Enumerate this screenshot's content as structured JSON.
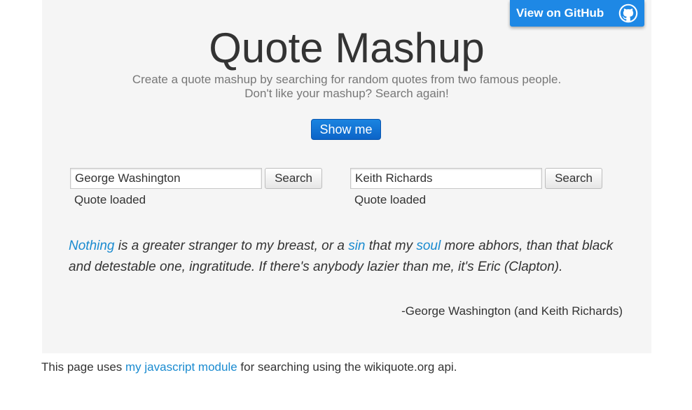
{
  "github": {
    "label": "View on GitHub",
    "icon": "github-octocat-icon"
  },
  "header": {
    "title": "Quote Mashup",
    "subtitle_line1": "Create a quote mashup by searching for random quotes from two famous people.",
    "subtitle_line2": "Don't like your mashup? Search again!"
  },
  "show_button": {
    "label": "Show me"
  },
  "search_left": {
    "value": "George Washington",
    "button": "Search",
    "status": "Quote loaded"
  },
  "search_right": {
    "value": "Keith Richards",
    "button": "Search",
    "status": "Quote loaded"
  },
  "quote": {
    "link1": "Nothing",
    "text1": " is a greater stranger to my breast, or a ",
    "link2": "sin",
    "text2": " that my ",
    "link3": "soul",
    "text3": " more abhors, than that black and detestable one, ingratitude. If there's anybody lazier than me, it's Eric (Clapton).",
    "attribution": "-George Washington (and Keith Richards)"
  },
  "footer": {
    "prefix": "This page uses ",
    "link": "my javascript module",
    "suffix": " for searching using the wikiquote.org api."
  },
  "colors": {
    "accent": "#1e88e5",
    "link": "#1a8bd0",
    "panel_bg": "#f5f5f5"
  }
}
